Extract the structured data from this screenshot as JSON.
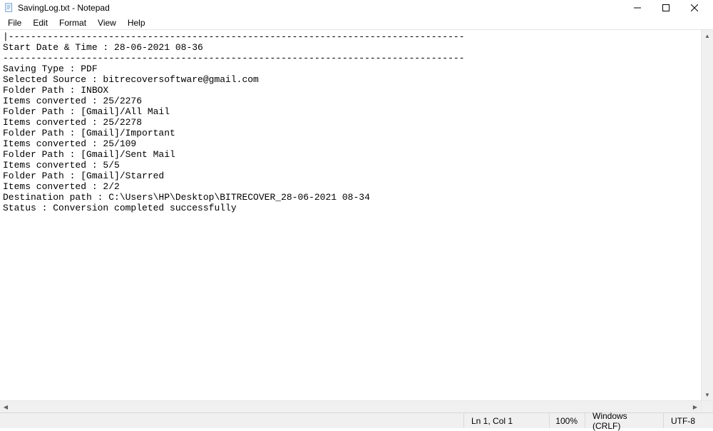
{
  "titlebar": {
    "filename": "SavingLog.txt",
    "appname": "Notepad",
    "title": "SavingLog.txt - Notepad"
  },
  "menubar": {
    "file": "File",
    "edit": "Edit",
    "format": "Format",
    "view": "View",
    "help": "Help"
  },
  "content": {
    "text": "|----------------------------------------------------------------------------------\nStart Date & Time : 28-06-2021 08-36\n-----------------------------------------------------------------------------------\nSaving Type : PDF\nSelected Source : bitrecoversoftware@gmail.com\nFolder Path : INBOX\nItems converted : 25/2276\nFolder Path : [Gmail]/All Mail\nItems converted : 25/2278\nFolder Path : [Gmail]/Important\nItems converted : 25/109\nFolder Path : [Gmail]/Sent Mail\nItems converted : 5/5\nFolder Path : [Gmail]/Starred\nItems converted : 2/2\nDestination path : C:\\Users\\HP\\Desktop\\BITRECOVER_28-06-2021 08-34\nStatus : Conversion completed successfully"
  },
  "statusbar": {
    "position": "Ln 1, Col 1",
    "zoom": "100%",
    "eol": "Windows (CRLF)",
    "encoding": "UTF-8"
  }
}
